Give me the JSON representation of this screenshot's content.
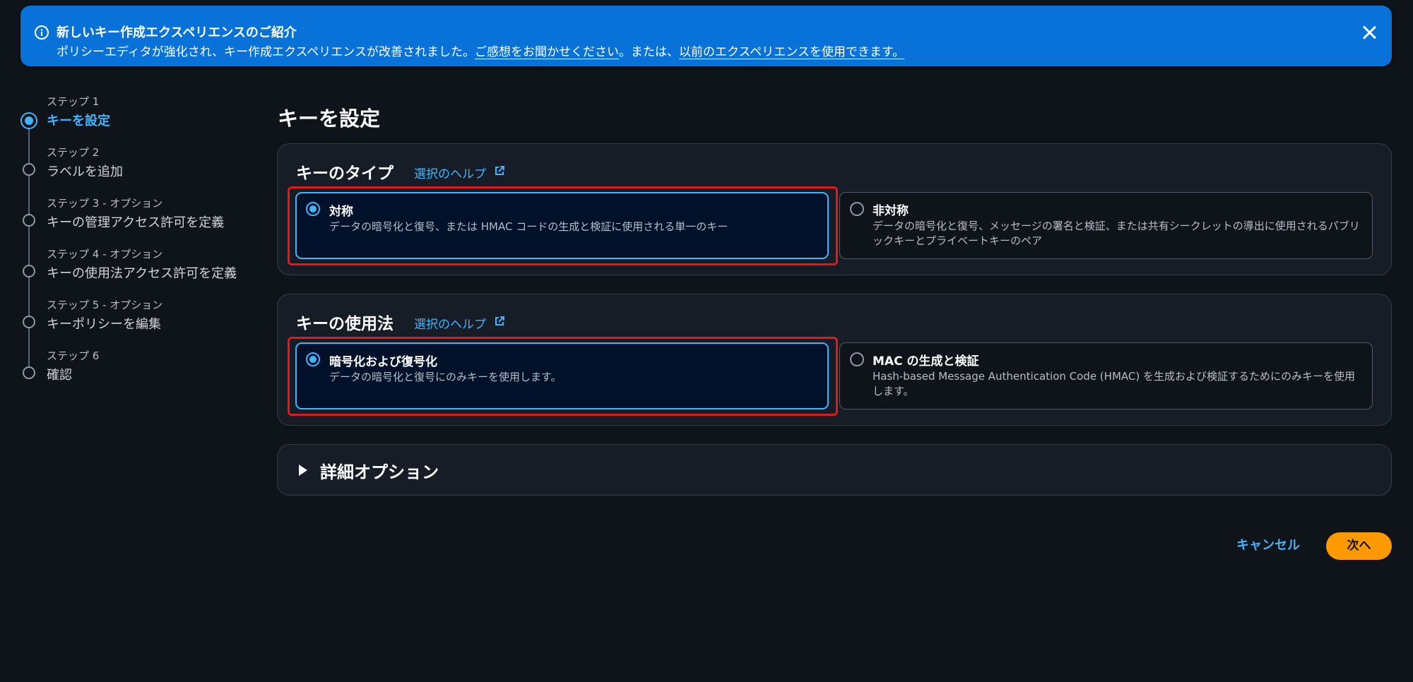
{
  "banner": {
    "title": "新しいキー作成エクスペリエンスのご紹介",
    "message": "ポリシーエディタが強化され、キー作成エクスペリエンスが改善されました。",
    "feedback_link": "ご感想をお聞かせください",
    "middle_text": "。または、",
    "previous_link": "以前のエクスペリエンスを使用できます。"
  },
  "steps": [
    {
      "label": "ステップ 1",
      "title": "キーを設定",
      "state": "active"
    },
    {
      "label": "ステップ 2",
      "title": "ラベルを追加",
      "state": "pending"
    },
    {
      "label": "ステップ 3 - オプション",
      "title": "キーの管理アクセス許可を定義",
      "state": "pending"
    },
    {
      "label": "ステップ 4 - オプション",
      "title": "キーの使用法アクセス許可を定義",
      "state": "pending"
    },
    {
      "label": "ステップ 5 - オプション",
      "title": "キーポリシーを編集",
      "state": "pending"
    },
    {
      "label": "ステップ 6",
      "title": "確認",
      "state": "pending"
    }
  ],
  "page_title": "キーを設定",
  "key_type": {
    "heading": "キーのタイプ",
    "help_link": "選択のヘルプ",
    "options": [
      {
        "title": "対称",
        "description": "データの暗号化と復号、または HMAC コードの生成と検証に使用される単一のキー",
        "selected": true
      },
      {
        "title": "非対称",
        "description": "データの暗号化と復号、メッセージの署名と検証、または共有シークレットの導出に使用されるパブリックキーとプライベートキーのペア",
        "selected": false
      }
    ]
  },
  "key_usage": {
    "heading": "キーの使用法",
    "help_link": "選択のヘルプ",
    "options": [
      {
        "title": "暗号化および復号化",
        "description": "データの暗号化と復号にのみキーを使用します。",
        "selected": true
      },
      {
        "title": "MAC の生成と検証",
        "description": "Hash-based Message Authentication Code (HMAC) を生成および検証するためにのみキーを使用します。",
        "selected": false
      }
    ]
  },
  "advanced": {
    "label": "詳細オプション"
  },
  "footer": {
    "cancel_label": "キャンセル",
    "next_label": "次へ"
  },
  "colors": {
    "accent": "#42b4ff",
    "banner": "#0872d9",
    "primary_button": "#ff9900",
    "highlight": "#e01a1a"
  }
}
